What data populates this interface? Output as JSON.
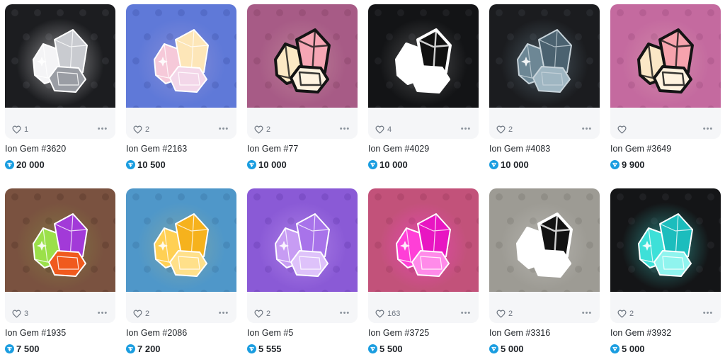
{
  "colors": {
    "ton": "#1a9de0",
    "card_footer": "#f5f6f8"
  },
  "items": [
    {
      "name": "Ion Gem #3620",
      "price": "20 000",
      "likes": "1",
      "bg": "#1c1d20",
      "motif": "#2a2b2f",
      "gem": [
        "#f4f4f6",
        "#c9cbd0",
        "#9a9da4"
      ],
      "outline": "#ffffff",
      "style": "glow"
    },
    {
      "name": "Ion Gem #2163",
      "price": "10 500",
      "likes": "2",
      "bg": "#5f79d8",
      "motif": "#546cc8",
      "gem": [
        "#f6c9d9",
        "#fde6b8",
        "#f3d7e9"
      ],
      "outline": "#ffffff",
      "style": "soft"
    },
    {
      "name": "Ion Gem #77",
      "price": "10 000",
      "likes": "2",
      "bg": "#a75b86",
      "motif": "#9a5179",
      "gem": [
        "#fbe9c4",
        "#f6a6b4",
        "#fff3e0"
      ],
      "outline": "#141414",
      "style": "outline"
    },
    {
      "name": "Ion Gem #4029",
      "price": "10 000",
      "likes": "4",
      "bg": "#131416",
      "motif": "#1e1f22",
      "gem": [
        "#ffffff",
        "#111111",
        "#ffffff"
      ],
      "outline": "#ffffff",
      "style": "outline-dark"
    },
    {
      "name": "Ion Gem #4083",
      "price": "10 000",
      "likes": "2",
      "bg": "#1b1c1f",
      "motif": "#26282c",
      "gem": [
        "#6d8795",
        "#4b6270",
        "#9fb6c2"
      ],
      "outline": "#c7d3da",
      "style": "glow"
    },
    {
      "name": "Ion Gem #3649",
      "price": "9 900",
      "likes": "",
      "bg": "#c46a9f",
      "motif": "#b65f93",
      "gem": [
        "#fbe7c6",
        "#f6a3ad",
        "#fff2df"
      ],
      "outline": "#141414",
      "style": "outline"
    },
    {
      "name": "Ion Gem #1935",
      "price": "7 500",
      "likes": "3",
      "bg": "#7a5240",
      "motif": "#6c4737",
      "gem": [
        "#9be04a",
        "#a23ad8",
        "#f05a1e"
      ],
      "outline": "#ffffff",
      "style": "soft"
    },
    {
      "name": "Ion Gem #2086",
      "price": "7 200",
      "likes": "2",
      "bg": "#4f97c9",
      "motif": "#478abb",
      "gem": [
        "#ffd054",
        "#f6b21d",
        "#ffe08a"
      ],
      "outline": "#ffffff",
      "style": "soft"
    },
    {
      "name": "Ion Gem #5",
      "price": "5 555",
      "likes": "2",
      "bg": "#8a5ad6",
      "motif": "#7d4fc8",
      "gem": [
        "#c79cf3",
        "#a873ea",
        "#dec2fa"
      ],
      "outline": "#ffffff",
      "style": "glow"
    },
    {
      "name": "Ion Gem #3725",
      "price": "5 500",
      "likes": "163",
      "bg": "#c2527a",
      "motif": "#b4496f",
      "gem": [
        "#ff3fd7",
        "#e816c2",
        "#ff8ae9"
      ],
      "outline": "#ffffff",
      "style": "glow"
    },
    {
      "name": "Ion Gem #3316",
      "price": "5 000",
      "likes": "2",
      "bg": "#9d9b94",
      "motif": "#908e87",
      "gem": [
        "#ffffff",
        "#121212",
        "#ffffff"
      ],
      "outline": "#ffffff",
      "style": "outline-dark"
    },
    {
      "name": "Ion Gem #3932",
      "price": "5 000",
      "likes": "2",
      "bg": "#141517",
      "motif": "#1f2023",
      "gem": [
        "#3ee0d8",
        "#1cbdbd",
        "#8ff4ee"
      ],
      "outline": "#ffffff",
      "style": "glow"
    }
  ]
}
